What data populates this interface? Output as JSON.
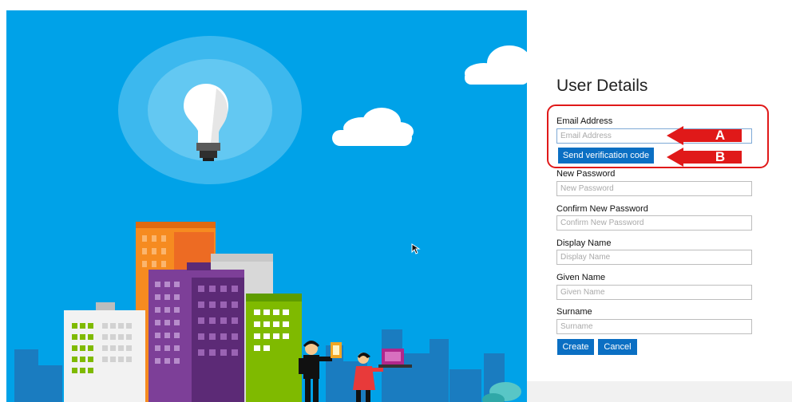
{
  "form": {
    "title": "User Details",
    "email": {
      "label": "Email Address",
      "placeholder": "Email Address",
      "value": ""
    },
    "send_code_label": "Send verification code",
    "new_password": {
      "label": "New Password",
      "placeholder": "New Password"
    },
    "confirm_password": {
      "label": "Confirm New Password",
      "placeholder": "Confirm New Password"
    },
    "display_name": {
      "label": "Display Name",
      "placeholder": "Display Name"
    },
    "given_name": {
      "label": "Given Name",
      "placeholder": "Given Name"
    },
    "surname": {
      "label": "Surname",
      "placeholder": "Surname"
    },
    "create_label": "Create",
    "cancel_label": "Cancel"
  },
  "annotations": {
    "arrow_a": "A",
    "arrow_b": "B"
  },
  "colors": {
    "sky": "#00a2e8",
    "button": "#0b6fc3",
    "annotation_red": "#e01919"
  },
  "icons": [
    "lightbulb-icon",
    "cloud-icon",
    "mouse-cursor-icon"
  ]
}
